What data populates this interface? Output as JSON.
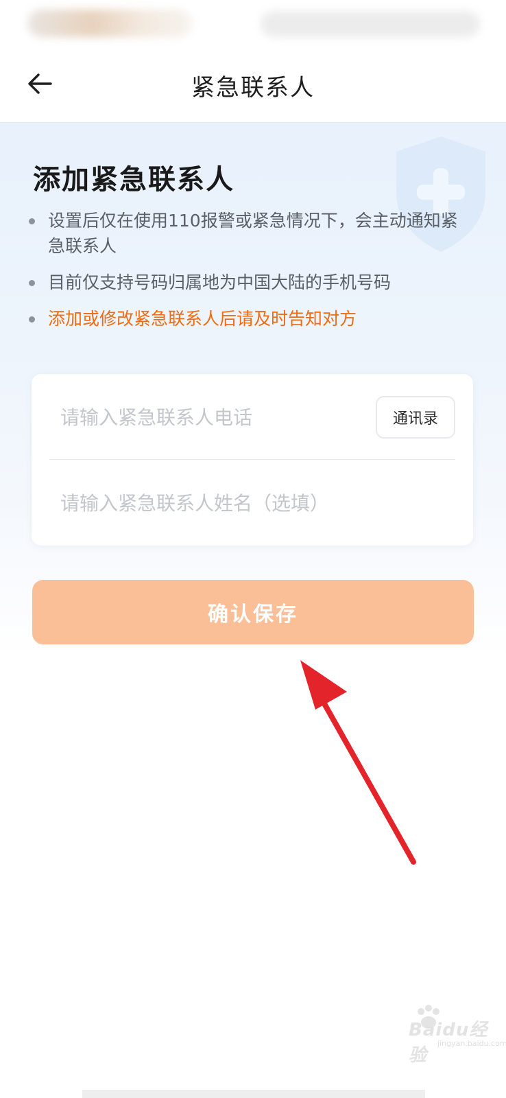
{
  "header": {
    "title": "紧急联系人",
    "back_icon": "arrow-left-icon"
  },
  "intro": {
    "heading": "添加紧急联系人",
    "notes": [
      "设置后仅在使用110报警或紧急情况下，会主动通知紧急联系人",
      "目前仅支持号码归属地为中国大陆的手机号码",
      "添加或修改紧急联系人后请及时告知对方"
    ],
    "decoration_icon": "shield-plus-icon"
  },
  "form": {
    "phone_placeholder": "请输入紧急联系人电话",
    "contacts_button": "通讯录",
    "name_placeholder": "请输入紧急联系人姓名（选填）"
  },
  "actions": {
    "save_label": "确认保存"
  },
  "watermark": {
    "text": "Baidu经验",
    "sub": "jingyan.baidu.com"
  },
  "colors": {
    "accent_orange": "#ef6b14",
    "save_button": "#fbbf98",
    "hero_background": "#e8f1fc",
    "annotation_arrow": "#e3242b"
  }
}
